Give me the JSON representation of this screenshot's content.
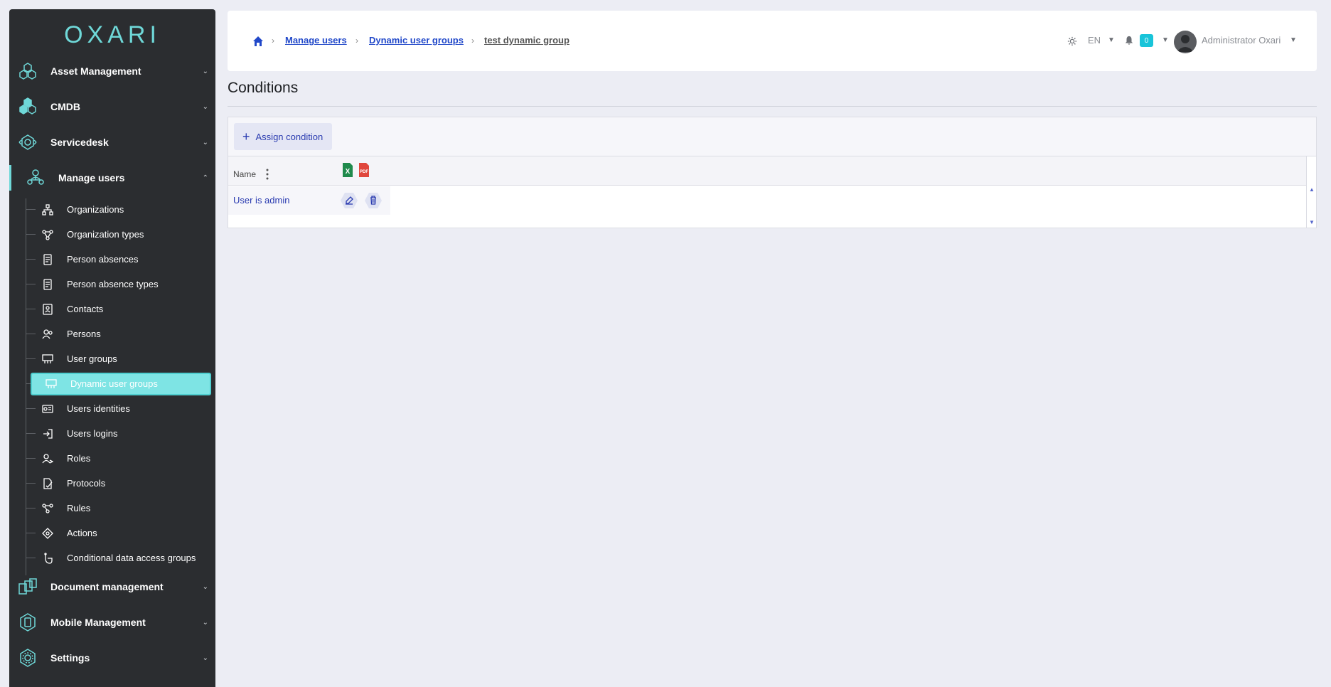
{
  "sidebar": {
    "logo": "OXARI",
    "sections": [
      {
        "label": "Asset Management",
        "icon": "asset-management-icon"
      },
      {
        "label": "CMDB",
        "icon": "cmdb-icon"
      },
      {
        "label": "Servicedesk",
        "icon": "servicedesk-icon"
      },
      {
        "label": "Manage users",
        "icon": "manage-users-icon"
      },
      {
        "label": "Document management",
        "icon": "document-management-icon"
      },
      {
        "label": "Mobile Management",
        "icon": "mobile-management-icon"
      },
      {
        "label": "Settings",
        "icon": "settings-icon"
      }
    ],
    "submenu": [
      {
        "label": "Organizations",
        "icon": "organizations-icon"
      },
      {
        "label": "Organization types",
        "icon": "organization-types-icon"
      },
      {
        "label": "Person absences",
        "icon": "person-absences-icon"
      },
      {
        "label": "Person absence types",
        "icon": "person-absence-types-icon"
      },
      {
        "label": "Contacts",
        "icon": "contacts-icon"
      },
      {
        "label": "Persons",
        "icon": "persons-icon"
      },
      {
        "label": "User groups",
        "icon": "user-groups-icon"
      },
      {
        "label": "Dynamic user groups",
        "icon": "dynamic-user-groups-icon"
      },
      {
        "label": "Users identities",
        "icon": "users-identities-icon"
      },
      {
        "label": "Users logins",
        "icon": "users-logins-icon"
      },
      {
        "label": "Roles",
        "icon": "roles-icon"
      },
      {
        "label": "Protocols",
        "icon": "protocols-icon"
      },
      {
        "label": "Rules",
        "icon": "rules-icon"
      },
      {
        "label": "Actions",
        "icon": "actions-icon"
      },
      {
        "label": "Conditional data access groups",
        "icon": "conditional-data-access-icon"
      }
    ],
    "selected": "Dynamic user groups"
  },
  "header": {
    "breadcrumb": [
      "Manage users",
      "Dynamic user groups",
      "test dynamic group"
    ],
    "language": "EN",
    "notifications_count": "0",
    "user_name": "Administrator Oxari"
  },
  "main": {
    "title": "Conditions",
    "assign_button": "Assign condition",
    "grid": {
      "column_name": "Name",
      "rows": [
        {
          "name": "User is admin"
        }
      ]
    }
  },
  "colors": {
    "accent": "#6fd8d8",
    "sidebar_bg": "#2b2d30",
    "link": "#2148c9",
    "badge": "#19c4d9"
  }
}
